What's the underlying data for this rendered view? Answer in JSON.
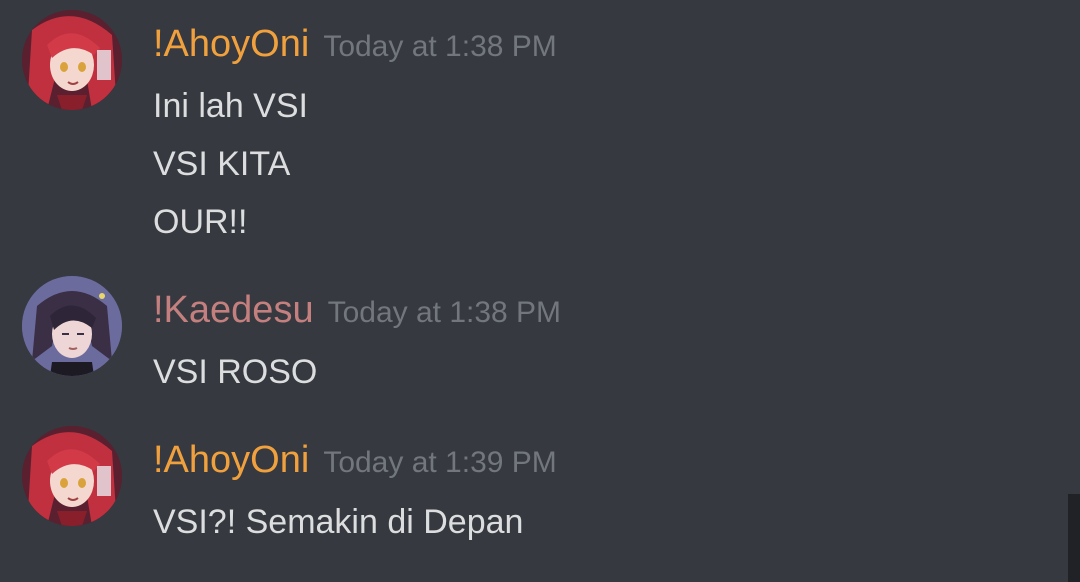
{
  "messages": [
    {
      "username": "!AhoyOni",
      "timestamp": "Today at 1:38 PM",
      "lines": [
        "Ini lah VSI",
        "VSI KITA",
        "OUR!!"
      ],
      "name_color": "#f0a13e",
      "avatar": "red-hair-anime-avatar"
    },
    {
      "username": "!Kaedesu",
      "timestamp": "Today at 1:38 PM",
      "lines": [
        "VSI ROSO"
      ],
      "name_color": "#c47f7f",
      "avatar": "purple-hair-anime-avatar"
    },
    {
      "username": "!AhoyOni",
      "timestamp": "Today at 1:39 PM",
      "lines": [
        "VSI?! Semakin di Depan"
      ],
      "name_color": "#f0a13e",
      "avatar": "red-hair-anime-avatar"
    }
  ],
  "colors": {
    "background": "#36393f",
    "message_text": "#dcddde",
    "timestamp": "#72767d"
  }
}
